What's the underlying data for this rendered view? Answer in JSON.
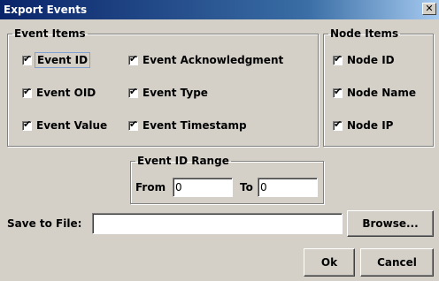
{
  "window": {
    "title": "Export Events",
    "close_glyph": "✕"
  },
  "event_items": {
    "legend": "Event Items",
    "checkboxes": [
      {
        "label": "Event ID",
        "checked": true
      },
      {
        "label": "Event OID",
        "checked": true
      },
      {
        "label": "Event Value",
        "checked": true
      },
      {
        "label": "Event Acknowledgment",
        "checked": true
      },
      {
        "label": "Event Type",
        "checked": true
      },
      {
        "label": "Event Timestamp",
        "checked": true
      }
    ]
  },
  "node_items": {
    "legend": "Node Items",
    "checkboxes": [
      {
        "label": "Node ID",
        "checked": true
      },
      {
        "label": "Node Name",
        "checked": true
      },
      {
        "label": "Node IP",
        "checked": true
      }
    ]
  },
  "range": {
    "legend": "Event ID Range",
    "from_label": "From",
    "from_value": "0",
    "to_label": "To",
    "to_value": "0"
  },
  "save": {
    "label": "Save to File:",
    "value": "",
    "browse_label": "Browse..."
  },
  "buttons": {
    "ok_label": "Ok",
    "cancel_label": "Cancel"
  },
  "check_glyph": "✔",
  "colors": {
    "titlebar_start": "#0a246a",
    "titlebar_end": "#a6caf0",
    "dialog_bg": "#d4d0c8"
  }
}
